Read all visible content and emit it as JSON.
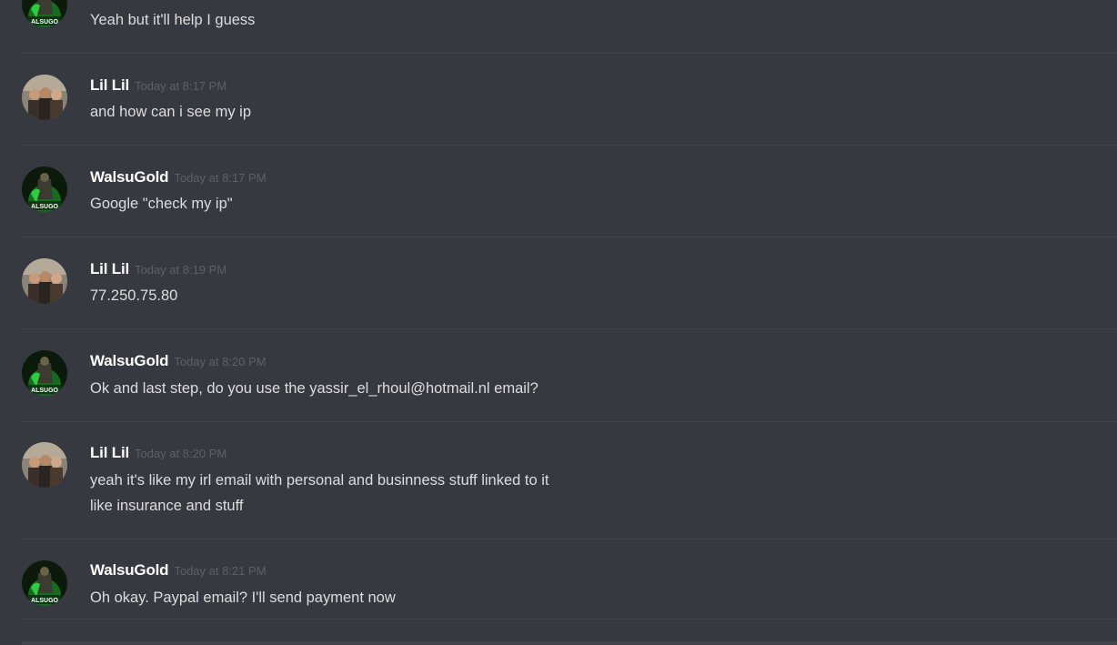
{
  "messages": [
    {
      "author": "",
      "timestamp": "",
      "lines": [
        "Yeah but it'll help I guess"
      ]
    },
    {
      "author": "Lil Lil",
      "timestamp": "Today at 8:17 PM",
      "lines": [
        "and how can i see my ip"
      ]
    },
    {
      "author": "WalsuGold",
      "timestamp": "Today at 8:17 PM",
      "lines": [
        "Google \"check my ip\""
      ]
    },
    {
      "author": "Lil Lil",
      "timestamp": "Today at 8:19 PM",
      "lines": [
        "77.250.75.80"
      ]
    },
    {
      "author": "WalsuGold",
      "timestamp": "Today at 8:20 PM",
      "lines": [
        "Ok and last step, do you use the yassir_el_rhoul@hotmail.nl email?"
      ]
    },
    {
      "author": "Lil Lil",
      "timestamp": "Today at 8:20 PM",
      "lines": [
        "yeah it's like my irl email with personal and businness stuff linked to it",
        "like insurance and stuff"
      ]
    },
    {
      "author": "WalsuGold",
      "timestamp": "Today at 8:21 PM",
      "lines": [
        "Oh okay. Paypal email? I'll send payment now"
      ]
    }
  ],
  "avatar_badge_text": "ALSUGO",
  "colors": {
    "background": "#36393f",
    "username": "#ffffff",
    "timestamp": "#5d6066",
    "message_text": "#dcddde",
    "walsu_avatar_accent": "#2ecc40"
  }
}
